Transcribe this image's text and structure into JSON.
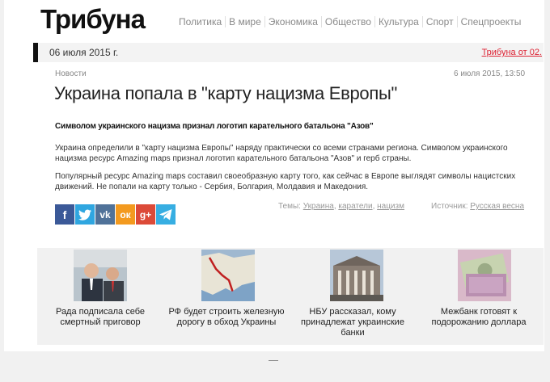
{
  "site": {
    "logo": "Трибуна",
    "nav": [
      "Политика",
      "В мире",
      "Экономика",
      "Общество",
      "Культура",
      "Спорт",
      "Спецпроекты"
    ]
  },
  "datebar": {
    "date": "06 июля 2015 г.",
    "promo": "Трибуна от 02."
  },
  "article": {
    "section": "Новости",
    "published": "6 июля 2015, 13:50",
    "title": "Украина попала в \"карту нацизма Европы\"",
    "lead": "Символом украинского нацизма признал логотип карательного батальона \"Азов\"",
    "paragraphs": [
      "Украина определили в \"карту нацизма Европы\" наряду практически со всеми странами региона. Символом украинского нацизма ресурс Amazing maps признал логотип карательного батальона \"Азов\" и герб страны.",
      "Популярный ресурс Amazing maps составил своеобразную карту того, как сейчас в Европе выглядят символы нацистских движений. Не попали на карту только - Сербия, Болгария, Молдавия и Македония."
    ],
    "topics_label": "Темы:",
    "topics": [
      "Украина",
      "каратели",
      "нацизм"
    ],
    "source_label": "Источник:",
    "source": "Русская весна"
  },
  "social": [
    {
      "name": "facebook",
      "glyph": "f",
      "color": "#3b5998"
    },
    {
      "name": "twitter",
      "glyph": "t",
      "color": "#2fa6e0"
    },
    {
      "name": "vkontakte",
      "glyph": "vk",
      "color": "#507299"
    },
    {
      "name": "odnoklassniki",
      "glyph": "ок",
      "color": "#f39a1f"
    },
    {
      "name": "google-plus",
      "glyph": "g+",
      "color": "#dc4a38"
    },
    {
      "name": "telegram",
      "glyph": "➤",
      "color": "#37aee2"
    }
  ],
  "related": [
    {
      "caption": "Рада подписала себе смертный приговор",
      "icon": "politicians-photo"
    },
    {
      "caption": "РФ будет строить железную дорогу в обход Украины",
      "icon": "railway-map"
    },
    {
      "caption": "НБУ рассказал, кому принадлежат украинские банки",
      "icon": "bank-building-photo"
    },
    {
      "caption": "Межбанк готовят к подорожанию доллара",
      "icon": "dollar-bills-photo"
    }
  ]
}
